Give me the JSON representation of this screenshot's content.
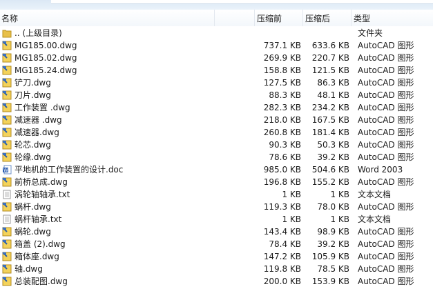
{
  "header": {
    "name": "名称",
    "before": "压缩前",
    "after": "压缩后",
    "type": "类型"
  },
  "rows": [
    {
      "name": ".. (上级目录)",
      "before": "",
      "after": "",
      "type": "文件夹",
      "icon": "folder"
    },
    {
      "name": "MG185.00.dwg",
      "before": "737.1 KB",
      "after": "633.6 KB",
      "type": "AutoCAD 图形",
      "icon": "dwg"
    },
    {
      "name": "MG185.02.dwg",
      "before": "269.9 KB",
      "after": "220.7 KB",
      "type": "AutoCAD 图形",
      "icon": "dwg"
    },
    {
      "name": "MG185.24.dwg",
      "before": "158.8 KB",
      "after": "121.5 KB",
      "type": "AutoCAD 图形",
      "icon": "dwg"
    },
    {
      "name": "铲刀.dwg",
      "before": "127.5 KB",
      "after": "86.3 KB",
      "type": "AutoCAD 图形",
      "icon": "dwg"
    },
    {
      "name": "刀片.dwg",
      "before": "88.3 KB",
      "after": "48.1 KB",
      "type": "AutoCAD 图形",
      "icon": "dwg"
    },
    {
      "name": "工作装置 .dwg",
      "before": "282.3 KB",
      "after": "234.2 KB",
      "type": "AutoCAD 图形",
      "icon": "dwg"
    },
    {
      "name": "减速器 .dwg",
      "before": "218.0 KB",
      "after": "167.5 KB",
      "type": "AutoCAD 图形",
      "icon": "dwg"
    },
    {
      "name": "减速器.dwg",
      "before": "260.8 KB",
      "after": "181.4 KB",
      "type": "AutoCAD 图形",
      "icon": "dwg"
    },
    {
      "name": "轮芯.dwg",
      "before": "90.3 KB",
      "after": "50.3 KB",
      "type": "AutoCAD 图形",
      "icon": "dwg"
    },
    {
      "name": "轮缘.dwg",
      "before": "78.6 KB",
      "after": "39.2 KB",
      "type": "AutoCAD 图形",
      "icon": "dwg"
    },
    {
      "name": "平地机的工作装置的设计.doc",
      "before": "985.0 KB",
      "after": "504.6 KB",
      "type": "Word 2003",
      "icon": "doc"
    },
    {
      "name": "前桥总成.dwg",
      "before": "196.8 KB",
      "after": "155.2 KB",
      "type": "AutoCAD 图形",
      "icon": "dwg"
    },
    {
      "name": "涡轮轴轴承.txt",
      "before": "1 KB",
      "after": "1 KB",
      "type": "文本文档",
      "icon": "txt"
    },
    {
      "name": "蜗杆.dwg",
      "before": "119.3 KB",
      "after": "78.0 KB",
      "type": "AutoCAD 图形",
      "icon": "dwg"
    },
    {
      "name": "蜗杆轴承.txt",
      "before": "1 KB",
      "after": "1 KB",
      "type": "文本文档",
      "icon": "txt"
    },
    {
      "name": "蜗轮.dwg",
      "before": "143.4 KB",
      "after": "98.9 KB",
      "type": "AutoCAD 图形",
      "icon": "dwg"
    },
    {
      "name": "箱盖 (2).dwg",
      "before": "78.4 KB",
      "after": "39.2 KB",
      "type": "AutoCAD 图形",
      "icon": "dwg"
    },
    {
      "name": "箱体座.dwg",
      "before": "147.2 KB",
      "after": "105.9 KB",
      "type": "AutoCAD 图形",
      "icon": "dwg"
    },
    {
      "name": "轴.dwg",
      "before": "119.8 KB",
      "after": "78.5 KB",
      "type": "AutoCAD 图形",
      "icon": "dwg"
    },
    {
      "name": "总装配图.dwg",
      "before": "200.0 KB",
      "after": "153.9 KB",
      "type": "AutoCAD 图形",
      "icon": "dwg"
    }
  ]
}
